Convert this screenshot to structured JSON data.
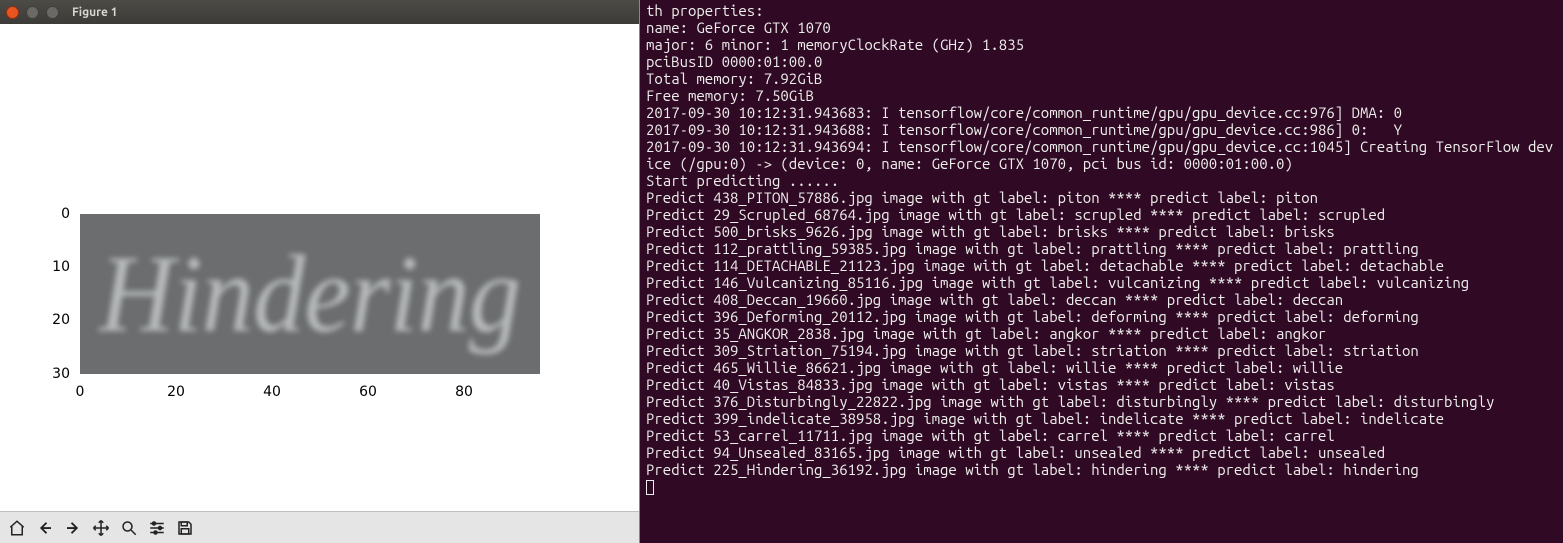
{
  "window": {
    "title": "Figure 1"
  },
  "plot": {
    "display_text": "Hindering",
    "yticks": [
      "0",
      "10",
      "20",
      "30"
    ],
    "ytick_pos": [
      0,
      53,
      106,
      160
    ],
    "xticks": [
      "0",
      "20",
      "40",
      "60",
      "80"
    ],
    "xtick_pos": [
      0,
      96,
      192,
      288,
      384
    ]
  },
  "toolbar": {
    "home": "⌂",
    "back": "←",
    "forward": "→",
    "pan": "✥",
    "zoom": "🔍",
    "config": "≡",
    "save": "💾"
  },
  "terminal": {
    "lines": [
      "th properties:",
      "name: GeForce GTX 1070",
      "major: 6 minor: 1 memoryClockRate (GHz) 1.835",
      "pciBusID 0000:01:00.0",
      "Total memory: 7.92GiB",
      "Free memory: 7.50GiB",
      "2017-09-30 10:12:31.943683: I tensorflow/core/common_runtime/gpu/gpu_device.cc:976] DMA: 0",
      "2017-09-30 10:12:31.943688: I tensorflow/core/common_runtime/gpu/gpu_device.cc:986] 0:   Y",
      "2017-09-30 10:12:31.943694: I tensorflow/core/common_runtime/gpu/gpu_device.cc:1045] Creating TensorFlow device (/gpu:0) -> (device: 0, name: GeForce GTX 1070, pci bus id: 0000:01:00.0)",
      "Start predicting ......",
      "Predict 438_PITON_57886.jpg image with gt label: piton **** predict label: piton",
      "Predict 29_Scrupled_68764.jpg image with gt label: scrupled **** predict label: scrupled",
      "Predict 500_brisks_9626.jpg image with gt label: brisks **** predict label: brisks",
      "Predict 112_prattling_59385.jpg image with gt label: prattling **** predict label: prattling",
      "Predict 114_DETACHABLE_21123.jpg image with gt label: detachable **** predict label: detachable",
      "Predict 146_Vulcanizing_85116.jpg image with gt label: vulcanizing **** predict label: vulcanizing",
      "Predict 408_Deccan_19660.jpg image with gt label: deccan **** predict label: deccan",
      "Predict 396_Deforming_20112.jpg image with gt label: deforming **** predict label: deforming",
      "Predict 35_ANGKOR_2838.jpg image with gt label: angkor **** predict label: angkor",
      "Predict 309_Striation_75194.jpg image with gt label: striation **** predict label: striation",
      "Predict 465_Willie_86621.jpg image with gt label: willie **** predict label: willie",
      "Predict 40_Vistas_84833.jpg image with gt label: vistas **** predict label: vistas",
      "Predict 376_Disturbingly_22822.jpg image with gt label: disturbingly **** predict label: disturbingly",
      "Predict 399_indelicate_38958.jpg image with gt label: indelicate **** predict label: indelicate",
      "Predict 53_carrel_11711.jpg image with gt label: carrel **** predict label: carrel",
      "Predict 94_Unsealed_83165.jpg image with gt label: unsealed **** predict label: unsealed",
      "Predict 225_Hindering_36192.jpg image with gt label: hindering **** predict label: hindering"
    ]
  },
  "chart_data": {
    "type": "heatmap",
    "title": "",
    "xlabel": "",
    "ylabel": "",
    "xlim": [
      0,
      100
    ],
    "ylim": [
      0,
      32
    ],
    "xticks": [
      0,
      20,
      40,
      60,
      80
    ],
    "yticks": [
      0,
      10,
      20,
      30
    ],
    "description": "Grayscale image (approx 100×32) containing the text 'Hindering' rendered in blurred italic serif, used as input for OCR prediction."
  }
}
